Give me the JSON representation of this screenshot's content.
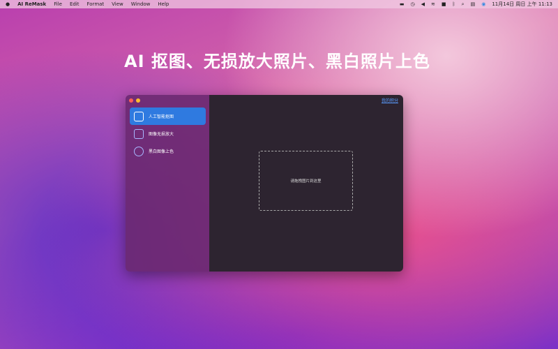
{
  "menubar": {
    "app": "AI ReMask",
    "items": [
      "File",
      "Edit",
      "Format",
      "View",
      "Window",
      "Help"
    ],
    "clock": "11月14日 周日 上午 11:13"
  },
  "headline": "AI 抠图、无损放大照片、黑白照片上色",
  "window": {
    "sidebar": [
      {
        "label": "人工智能抠图",
        "icon": "magic-cutout-icon",
        "active": true
      },
      {
        "label": "图像无损放大",
        "icon": "upscale-icon"
      },
      {
        "label": "黑白图像上色",
        "icon": "palette-icon"
      }
    ],
    "points_link": "我的积分",
    "drop_zone": "请拖拽图片到这里"
  },
  "colors": {
    "accent": "#2f7ae0",
    "link": "#5a9cff"
  }
}
